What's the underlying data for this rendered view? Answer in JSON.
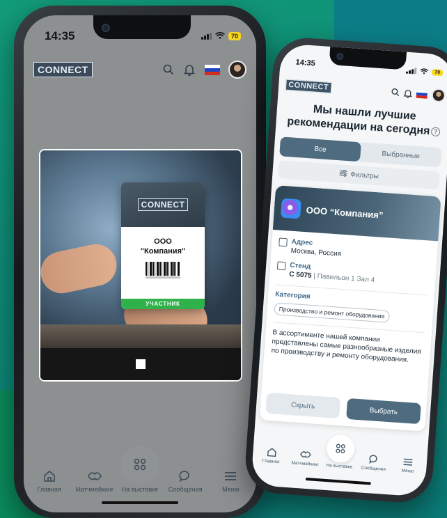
{
  "colors": {
    "accent": "#4e6b80",
    "badge_green": "#2fb24c",
    "flag": [
      "#ffffff",
      "#1e44c8",
      "#d52b1e"
    ],
    "battery": "#f6d61f"
  },
  "phone_left": {
    "status": {
      "time": "14:35",
      "battery": "70"
    },
    "header": {
      "logo": "CONNECT",
      "icons": [
        "search-icon",
        "bell-icon",
        "flag-icon",
        "avatar"
      ]
    },
    "badge": {
      "logo": "CONNECT",
      "name_line1": "ООО",
      "name_line2": "\"Компания\"",
      "role": "УЧАСТНИК"
    },
    "nav": [
      {
        "label": "Главная",
        "icon": "home-icon"
      },
      {
        "label": "Матчмейкинг",
        "icon": "handshake-icon"
      },
      {
        "label": "На выставке",
        "icon": "grid-icon"
      },
      {
        "label": "Сообщения",
        "icon": "chat-icon"
      },
      {
        "label": "Меню",
        "icon": "menu-icon"
      }
    ]
  },
  "phone_right": {
    "status": {
      "time": "14:35",
      "battery": "70"
    },
    "header": {
      "logo": "CONNECT"
    },
    "headline_line1": "Мы нашли лучшие",
    "headline_line2": "рекомендации на сегодня",
    "tabs": [
      {
        "label": "Все",
        "active": true
      },
      {
        "label": "Выбранные",
        "active": false
      }
    ],
    "filters_label": "Фильтры",
    "card": {
      "title": "ООО “Компания”",
      "address_label": "Адрес",
      "address_value": "Москва, Россия",
      "stand_label": "Стенд",
      "stand_code": "С 5075",
      "stand_place": "Павильон 1 Зал 4",
      "category_label": "Категория",
      "category_value": "Производство и ремонт оборудования",
      "description": "В ассортименте нашей компании представлены самые разнообразные изделия по производству и ремонту оборудования.",
      "hide_label": "Скрыть",
      "choose_label": "Выбрать"
    },
    "nav": [
      {
        "label": "Главная",
        "icon": "home-icon"
      },
      {
        "label": "Матчмейкинг",
        "icon": "handshake-icon"
      },
      {
        "label": "На выставке",
        "icon": "grid-icon"
      },
      {
        "label": "Сообщения",
        "icon": "chat-icon"
      },
      {
        "label": "Меню",
        "icon": "menu-icon"
      }
    ]
  }
}
